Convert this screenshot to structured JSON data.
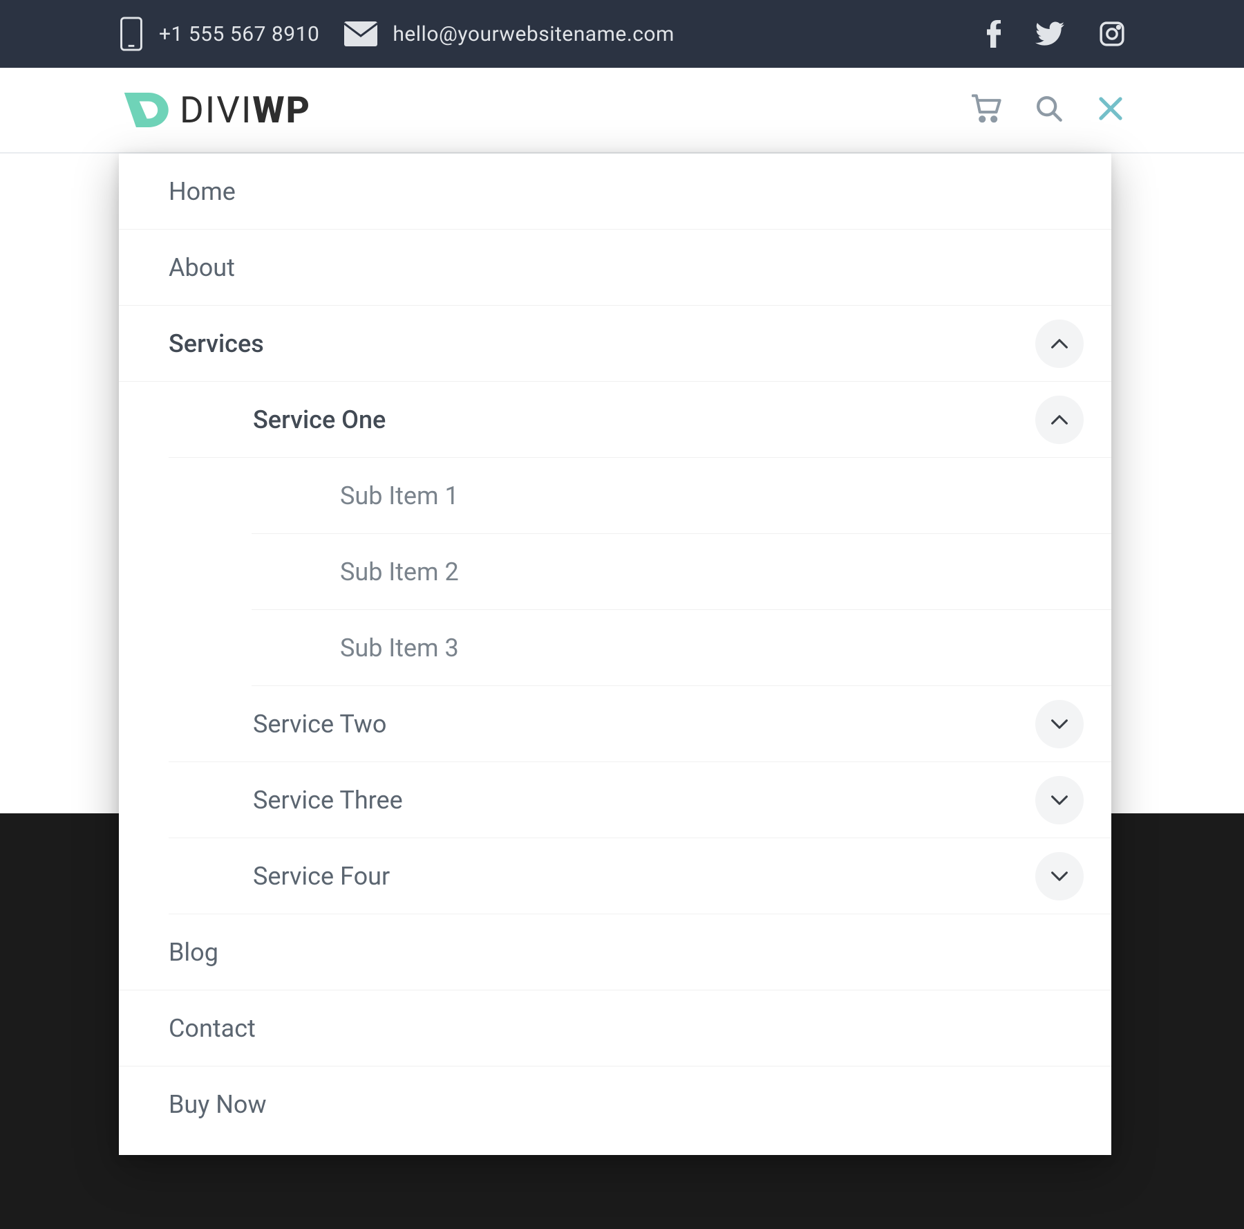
{
  "topbar": {
    "phone": "+1 555 567 8910",
    "email": "hello@yourwebsitename.com"
  },
  "logo": {
    "part1": "DIVI",
    "part2": "WP"
  },
  "menu": {
    "home": "Home",
    "about": "About",
    "services": "Services",
    "service_one": "Service One",
    "sub1": "Sub Item 1",
    "sub2": "Sub Item 2",
    "sub3": "Sub Item 3",
    "service_two": "Service Two",
    "service_three": "Service Three",
    "service_four": "Service Four",
    "blog": "Blog",
    "contact": "Contact",
    "buy_now": "Buy Now"
  }
}
